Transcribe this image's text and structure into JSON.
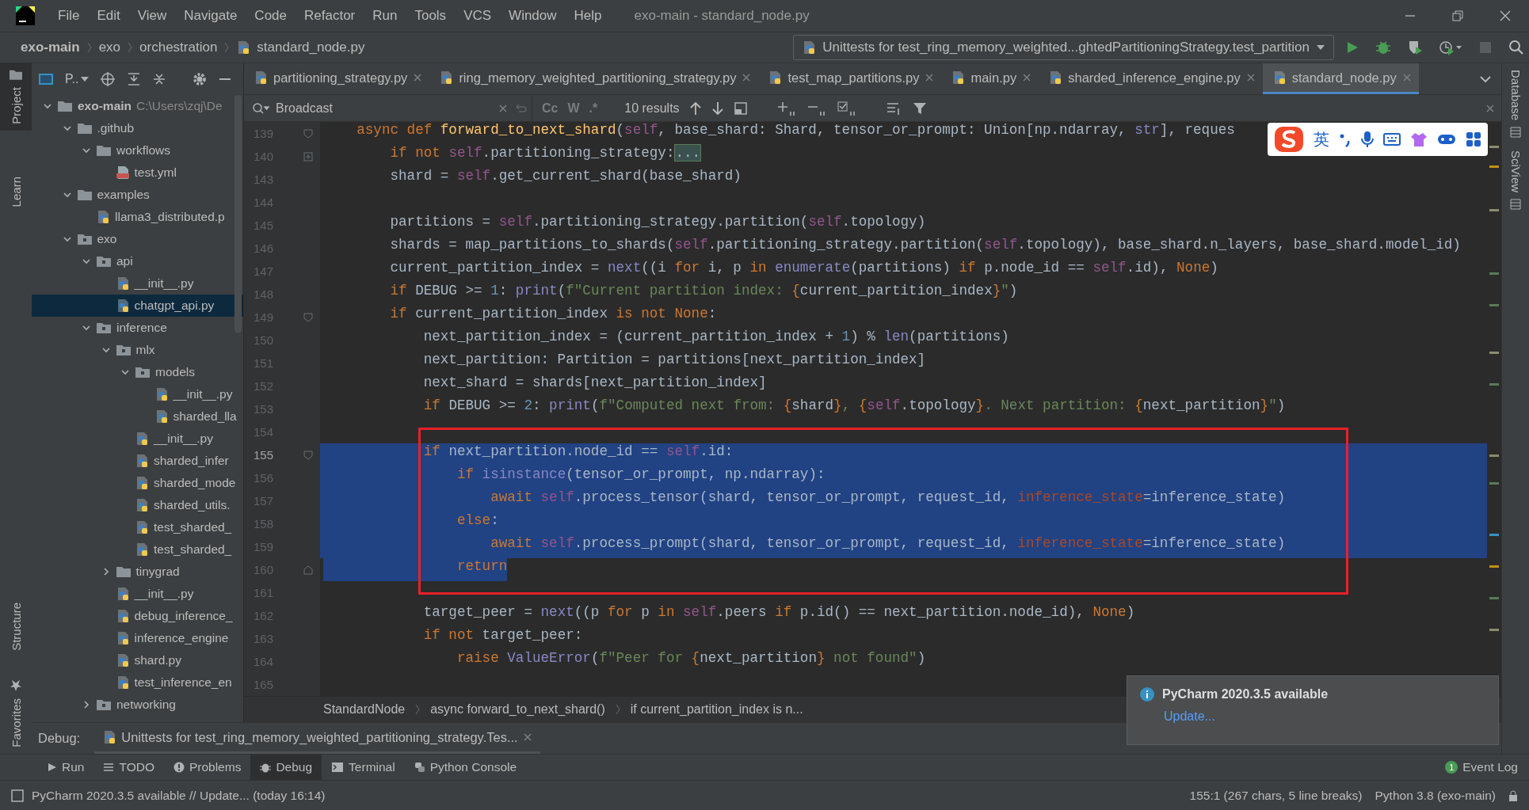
{
  "menu_bar": {
    "items": [
      "File",
      "Edit",
      "View",
      "Navigate",
      "Code",
      "Refactor",
      "Run",
      "Tools",
      "VCS",
      "Window",
      "Help"
    ],
    "title": "exo-main - standard_node.py"
  },
  "nav_bar": {
    "breadcrumbs": [
      "exo-main",
      "exo",
      "orchestration",
      "standard_node.py"
    ],
    "run_configuration": "Unittests for test_ring_memory_weighted...ghtedPartitioningStrategy.test_partition"
  },
  "left_stripe": [
    {
      "label": "Project",
      "selected": true
    },
    {
      "label": "Learn",
      "selected": false
    },
    {
      "label": "Structure",
      "selected": false
    },
    {
      "label": "Favorites",
      "selected": false
    }
  ],
  "right_stripe": [
    {
      "label": "Database",
      "selected": false
    },
    {
      "label": "SciView",
      "selected": false
    }
  ],
  "project_panel": {
    "view": "P..",
    "tree": [
      {
        "label": "exo-main",
        "path": "C:\\Users\\zqj\\De",
        "kind": "folder",
        "expanded": true,
        "selected": false,
        "children": [
          {
            "label": ".github",
            "kind": "folder",
            "expanded": true,
            "selected": false,
            "children": [
              {
                "label": "workflows",
                "kind": "folder",
                "expanded": true,
                "selected": false,
                "children": [
                  {
                    "label": "test.yml",
                    "kind": "yaml",
                    "selected": false
                  }
                ]
              }
            ]
          },
          {
            "label": "examples",
            "kind": "folder",
            "expanded": true,
            "selected": false,
            "children": [
              {
                "label": "llama3_distributed.p",
                "kind": "python",
                "selected": false
              }
            ]
          },
          {
            "label": "exo",
            "kind": "package",
            "expanded": true,
            "selected": false,
            "children": [
              {
                "label": "api",
                "kind": "package",
                "expanded": true,
                "selected": false,
                "children": [
                  {
                    "label": "__init__.py",
                    "kind": "python",
                    "selected": false
                  },
                  {
                    "label": "chatgpt_api.py",
                    "kind": "python",
                    "selected": true
                  }
                ]
              },
              {
                "label": "inference",
                "kind": "package",
                "expanded": true,
                "selected": false,
                "children": [
                  {
                    "label": "mlx",
                    "kind": "package",
                    "expanded": true,
                    "selected": false,
                    "children": [
                      {
                        "label": "models",
                        "kind": "package",
                        "expanded": true,
                        "selected": false,
                        "children": [
                          {
                            "label": "__init__.py",
                            "kind": "python",
                            "selected": false
                          },
                          {
                            "label": "sharded_lla",
                            "kind": "python",
                            "selected": false
                          }
                        ]
                      },
                      {
                        "label": "__init__.py",
                        "kind": "python",
                        "selected": false
                      },
                      {
                        "label": "sharded_infer",
                        "kind": "python",
                        "selected": false
                      },
                      {
                        "label": "sharded_mode",
                        "kind": "python",
                        "selected": false
                      },
                      {
                        "label": "sharded_utils.",
                        "kind": "python",
                        "selected": false
                      },
                      {
                        "label": "test_sharded_",
                        "kind": "python",
                        "selected": false
                      },
                      {
                        "label": "test_sharded_",
                        "kind": "python",
                        "selected": false
                      }
                    ]
                  },
                  {
                    "label": "tinygrad",
                    "kind": "folder",
                    "expanded": false,
                    "selected": false
                  },
                  {
                    "label": "__init__.py",
                    "kind": "python",
                    "selected": false
                  },
                  {
                    "label": "debug_inference_",
                    "kind": "python",
                    "selected": false
                  },
                  {
                    "label": "inference_engine",
                    "kind": "python",
                    "selected": false
                  },
                  {
                    "label": "shard.py",
                    "kind": "python",
                    "selected": false
                  },
                  {
                    "label": "test_inference_en",
                    "kind": "python",
                    "selected": false
                  }
                ]
              },
              {
                "label": "networking",
                "kind": "package",
                "expanded": false,
                "selected": false
              }
            ]
          }
        ]
      }
    ]
  },
  "editor": {
    "tabs": [
      {
        "label": "partitioning_strategy.py",
        "selected": false
      },
      {
        "label": "ring_memory_weighted_partitioning_strategy.py",
        "selected": false
      },
      {
        "label": "test_map_partitions.py",
        "selected": false
      },
      {
        "label": "main.py",
        "selected": false
      },
      {
        "label": "sharded_inference_engine.py",
        "selected": false
      },
      {
        "label": "standard_node.py",
        "selected": true
      }
    ],
    "find_bar": {
      "query": "Broadcast",
      "options": [
        "Cc",
        "W",
        ".*"
      ],
      "results": "10 results"
    },
    "lines": [
      {
        "number": "139",
        "selected": false,
        "fold_start": true,
        "tokens": [
          {
            "kind": "keyword",
            "text": "    async def "
          },
          {
            "kind": "function",
            "text": "forward_to_next_shard"
          },
          {
            "kind": "plain",
            "text": "("
          },
          {
            "kind": "self",
            "text": "self"
          },
          {
            "kind": "plain",
            "text": ", base_shard: Shard, tensor_or_prompt: Union[np.ndarray, "
          },
          {
            "kind": "builtin",
            "text": "str"
          },
          {
            "kind": "plain",
            "text": "], reques"
          }
        ]
      },
      {
        "number": "140",
        "selected": false,
        "collapsed": true,
        "tokens": [
          {
            "kind": "keyword",
            "text": "        if not "
          },
          {
            "kind": "self",
            "text": "self"
          },
          {
            "kind": "plain",
            "text": ".partitioning_strategy:"
          },
          {
            "kind": "folded",
            "text": "..."
          }
        ]
      },
      {
        "number": "143",
        "selected": false,
        "tokens": [
          {
            "kind": "plain",
            "text": "        shard = "
          },
          {
            "kind": "self",
            "text": "self"
          },
          {
            "kind": "plain",
            "text": ".get_current_shard(base_shard)"
          }
        ]
      },
      {
        "number": "144",
        "selected": false
      },
      {
        "number": "145",
        "selected": false,
        "tokens": [
          {
            "kind": "plain",
            "text": "        partitions = "
          },
          {
            "kind": "self",
            "text": "self"
          },
          {
            "kind": "plain",
            "text": ".partitioning_strategy.partition("
          },
          {
            "kind": "self",
            "text": "self"
          },
          {
            "kind": "plain",
            "text": ".topology)"
          }
        ]
      },
      {
        "number": "146",
        "selected": false,
        "tokens": [
          {
            "kind": "plain",
            "text": "        shards = map_partitions_to_shards("
          },
          {
            "kind": "self",
            "text": "self"
          },
          {
            "kind": "plain",
            "text": ".partitioning_strategy.partition("
          },
          {
            "kind": "self",
            "text": "self"
          },
          {
            "kind": "plain",
            "text": ".topology), base_shard.n_layers, base_shard.model_id)"
          }
        ]
      },
      {
        "number": "147",
        "selected": false,
        "tokens": [
          {
            "kind": "plain",
            "text": "        current_partition_index = "
          },
          {
            "kind": "builtin",
            "text": "next"
          },
          {
            "kind": "plain",
            "text": "((i "
          },
          {
            "kind": "keyword",
            "text": "for "
          },
          {
            "kind": "plain",
            "text": "i, p "
          },
          {
            "kind": "keyword",
            "text": "in "
          },
          {
            "kind": "builtin",
            "text": "enumerate"
          },
          {
            "kind": "plain",
            "text": "(partitions) "
          },
          {
            "kind": "keyword",
            "text": "if "
          },
          {
            "kind": "plain",
            "text": "p.node_id == "
          },
          {
            "kind": "self",
            "text": "self"
          },
          {
            "kind": "plain",
            "text": ".id), "
          },
          {
            "kind": "keyword",
            "text": "None"
          },
          {
            "kind": "plain",
            "text": ")"
          }
        ]
      },
      {
        "number": "148",
        "selected": false,
        "tokens": [
          {
            "kind": "keyword",
            "text": "        if "
          },
          {
            "kind": "plain",
            "text": "DEBUG >= "
          },
          {
            "kind": "number",
            "text": "1"
          },
          {
            "kind": "plain",
            "text": ": "
          },
          {
            "kind": "builtin",
            "text": "print"
          },
          {
            "kind": "plain",
            "text": "("
          },
          {
            "kind": "string",
            "text": "f\"Current partition index: "
          },
          {
            "kind": "keyword",
            "text": "{"
          },
          {
            "kind": "plain",
            "text": "current_partition_index"
          },
          {
            "kind": "keyword",
            "text": "}"
          },
          {
            "kind": "string",
            "text": "\""
          },
          {
            "kind": "plain",
            "text": ")"
          }
        ]
      },
      {
        "number": "149",
        "selected": false,
        "fold_start": true,
        "tokens": [
          {
            "kind": "keyword",
            "text": "        if "
          },
          {
            "kind": "plain",
            "text": "current_partition_index "
          },
          {
            "kind": "keyword",
            "text": "is not None"
          },
          {
            "kind": "plain",
            "text": ":"
          }
        ]
      },
      {
        "number": "150",
        "selected": false,
        "tokens": [
          {
            "kind": "plain",
            "text": "            next_partition_index = (current_partition_index + "
          },
          {
            "kind": "number",
            "text": "1"
          },
          {
            "kind": "plain",
            "text": ") % "
          },
          {
            "kind": "builtin",
            "text": "len"
          },
          {
            "kind": "plain",
            "text": "(partitions)"
          }
        ]
      },
      {
        "number": "151",
        "selected": false,
        "tokens": [
          {
            "kind": "plain",
            "text": "            next_partition: Partition = partitions[next_partition_index]"
          }
        ]
      },
      {
        "number": "152",
        "selected": false,
        "tokens": [
          {
            "kind": "plain",
            "text": "            next_shard = shards[next_partition_index]"
          }
        ]
      },
      {
        "number": "153",
        "selected": false,
        "tokens": [
          {
            "kind": "keyword",
            "text": "            if "
          },
          {
            "kind": "plain",
            "text": "DEBUG >= "
          },
          {
            "kind": "number",
            "text": "2"
          },
          {
            "kind": "plain",
            "text": ": "
          },
          {
            "kind": "builtin",
            "text": "print"
          },
          {
            "kind": "plain",
            "text": "("
          },
          {
            "kind": "string",
            "text": "f\"Computed next from: "
          },
          {
            "kind": "keyword",
            "text": "{"
          },
          {
            "kind": "plain",
            "text": "shard"
          },
          {
            "kind": "keyword",
            "text": "}"
          },
          {
            "kind": "string",
            "text": ", "
          },
          {
            "kind": "keyword",
            "text": "{"
          },
          {
            "kind": "self",
            "text": "self"
          },
          {
            "kind": "plain",
            "text": ".topology"
          },
          {
            "kind": "keyword",
            "text": "}"
          },
          {
            "kind": "string",
            "text": ". Next partition: "
          },
          {
            "kind": "keyword",
            "text": "{"
          },
          {
            "kind": "plain",
            "text": "next_partition"
          },
          {
            "kind": "keyword",
            "text": "}"
          },
          {
            "kind": "string",
            "text": "\""
          },
          {
            "kind": "plain",
            "text": ")"
          }
        ]
      },
      {
        "number": "154",
        "selected": false
      },
      {
        "number": "155",
        "selected": true,
        "fold_start": true,
        "tokens": [
          {
            "kind": "keyword",
            "text": "            if "
          },
          {
            "kind": "plain",
            "text": "next_partition.node_id == "
          },
          {
            "kind": "self",
            "text": "self"
          },
          {
            "kind": "plain",
            "text": ".id:"
          }
        ]
      },
      {
        "number": "156",
        "selected": true,
        "tokens": [
          {
            "kind": "keyword",
            "text": "                if "
          },
          {
            "kind": "builtin",
            "text": "isinstance"
          },
          {
            "kind": "plain",
            "text": "(tensor_or_prompt, np.ndarray):"
          }
        ]
      },
      {
        "number": "157",
        "selected": true,
        "tokens": [
          {
            "kind": "keyword",
            "text": "                    await "
          },
          {
            "kind": "self",
            "text": "self"
          },
          {
            "kind": "plain",
            "text": ".process_tensor(shard, tensor_or_prompt, request_id, "
          },
          {
            "kind": "param",
            "text": "inference_state"
          },
          {
            "kind": "plain",
            "text": "=inference_state)"
          }
        ]
      },
      {
        "number": "158",
        "selected": true,
        "tokens": [
          {
            "kind": "keyword",
            "text": "                else"
          },
          {
            "kind": "plain",
            "text": ":"
          }
        ]
      },
      {
        "number": "159",
        "selected": true,
        "tokens": [
          {
            "kind": "keyword",
            "text": "                    await "
          },
          {
            "kind": "self",
            "text": "self"
          },
          {
            "kind": "plain",
            "text": ".process_prompt(shard, tensor_or_prompt, request_id, "
          },
          {
            "kind": "param",
            "text": "inference_state"
          },
          {
            "kind": "plain",
            "text": "=inference_state)"
          }
        ]
      },
      {
        "number": "160",
        "selected": true,
        "fold_end": true,
        "tokens": [
          {
            "kind": "keyword",
            "text": "                return"
          }
        ]
      },
      {
        "number": "161",
        "selected": false
      },
      {
        "number": "162",
        "selected": false,
        "tokens": [
          {
            "kind": "plain",
            "text": "            target_peer = "
          },
          {
            "kind": "builtin",
            "text": "next"
          },
          {
            "kind": "plain",
            "text": "((p "
          },
          {
            "kind": "keyword",
            "text": "for "
          },
          {
            "kind": "plain",
            "text": "p "
          },
          {
            "kind": "keyword",
            "text": "in "
          },
          {
            "kind": "self",
            "text": "self"
          },
          {
            "kind": "plain",
            "text": ".peers "
          },
          {
            "kind": "keyword",
            "text": "if "
          },
          {
            "kind": "plain",
            "text": "p.id() == next_partition.node_id), "
          },
          {
            "kind": "keyword",
            "text": "None"
          },
          {
            "kind": "plain",
            "text": ")"
          }
        ]
      },
      {
        "number": "163",
        "selected": false,
        "tokens": [
          {
            "kind": "keyword",
            "text": "            if not "
          },
          {
            "kind": "plain",
            "text": "target_peer:"
          }
        ]
      },
      {
        "number": "164",
        "selected": false,
        "tokens": [
          {
            "kind": "keyword",
            "text": "                raise "
          },
          {
            "kind": "builtin",
            "text": "ValueError"
          },
          {
            "kind": "plain",
            "text": "("
          },
          {
            "kind": "string",
            "text": "f\"Peer for "
          },
          {
            "kind": "keyword",
            "text": "{"
          },
          {
            "kind": "plain",
            "text": "next_partition"
          },
          {
            "kind": "keyword",
            "text": "}"
          },
          {
            "kind": "string",
            "text": " not found\""
          },
          {
            "kind": "plain",
            "text": ")"
          }
        ]
      },
      {
        "number": "165",
        "selected": false
      }
    ],
    "breadcrumbs": [
      "StandardNode",
      "async forward_to_next_shard()",
      "if current_partition_index is n..."
    ]
  },
  "annotation": {
    "kind": "rectangle"
  },
  "ime_toolbar": {
    "mode": "英"
  },
  "notification": {
    "title": "PyCharm 2020.3.5 available",
    "action": "Update..."
  },
  "debug_bar": {
    "label": "Debug:",
    "session": "Unittests for test_ring_memory_weighted_partitioning_strategy.Tes..."
  },
  "tool_tabs": [
    {
      "label": "Run",
      "selected": false
    },
    {
      "label": "TODO",
      "selected": false
    },
    {
      "label": "Problems",
      "selected": false
    },
    {
      "label": "Debug",
      "selected": true
    },
    {
      "label": "Terminal",
      "selected": false
    },
    {
      "label": "Python Console",
      "selected": false
    }
  ],
  "event_log": {
    "label": "Event Log",
    "count": "1"
  },
  "status_bar": {
    "message": "PyCharm 2020.3.5 available // Update... (today 16:14)",
    "position": "155:1 (267 chars, 5 line breaks)",
    "interpreter": "Python 3.8 (exo-main)"
  }
}
